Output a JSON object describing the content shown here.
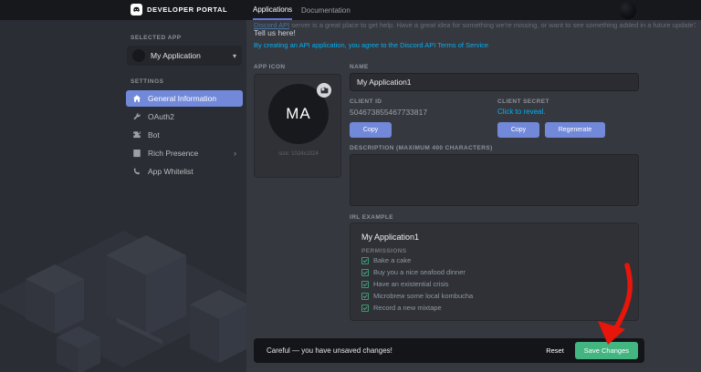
{
  "colors": {
    "accent_blurple": "#7289da",
    "link_blue": "#00b0f4",
    "success_green": "#43b581",
    "arrow_red": "#e8150b",
    "header_bg": "#17181c",
    "sidebar_bg": "#2b2d34",
    "main_bg": "#36383f"
  },
  "header": {
    "brand": "DEVELOPER PORTAL",
    "tabs": [
      {
        "label": "Applications",
        "active": true
      },
      {
        "label": "Documentation",
        "active": false
      }
    ]
  },
  "sidebar": {
    "selected_app_label": "SELECTED APP",
    "selected_app_name": "My Application",
    "settings_label": "SETTINGS",
    "items": [
      {
        "label": "General Information",
        "icon": "home-icon",
        "active": true
      },
      {
        "label": "OAuth2",
        "icon": "wrench-icon",
        "active": false
      },
      {
        "label": "Bot",
        "icon": "bot-icon",
        "active": false
      },
      {
        "label": "Rich Presence",
        "icon": "document-icon",
        "active": false,
        "has_chevron": true
      },
      {
        "label": "App Whitelist",
        "icon": "phone-icon",
        "active": false
      }
    ]
  },
  "main": {
    "intro_clipped": {
      "link": "Discord API",
      "text": "server is a great place to get help. Have a great idea for something we're missing, or want to see something added in a future update?"
    },
    "tell_us_link": "Tell us here!",
    "terms_notice": "By creating an API application, you agree to the Discord API Terms of Service",
    "app_icon": {
      "label": "APP ICON",
      "initials": "MA",
      "size_caption": "size: 1024x1024"
    },
    "name_field": {
      "label": "NAME",
      "value": "My Application1"
    },
    "client_id": {
      "label": "CLIENT ID",
      "value": "504673855467733817",
      "copy_label": "Copy"
    },
    "client_secret": {
      "label": "CLIENT SECRET",
      "reveal_label": "Click to reveal.",
      "copy_label": "Copy",
      "regenerate_label": "Regenerate"
    },
    "description": {
      "label": "DESCRIPTION (MAXIMUM 400 CHARACTERS)",
      "value": ""
    },
    "irl_example": {
      "label": "IRL EXAMPLE",
      "app_name": "My Application1",
      "permissions_label": "PERMISSIONS",
      "permissions": [
        "Bake a cake",
        "Buy you a nice seafood dinner",
        "Have an existential crisis",
        "Microbrew some local kombucha",
        "Record a new mixtape"
      ]
    }
  },
  "footer_bar": {
    "warning": "Careful — you have unsaved changes!",
    "reset_label": "Reset",
    "save_label": "Save Changes"
  }
}
